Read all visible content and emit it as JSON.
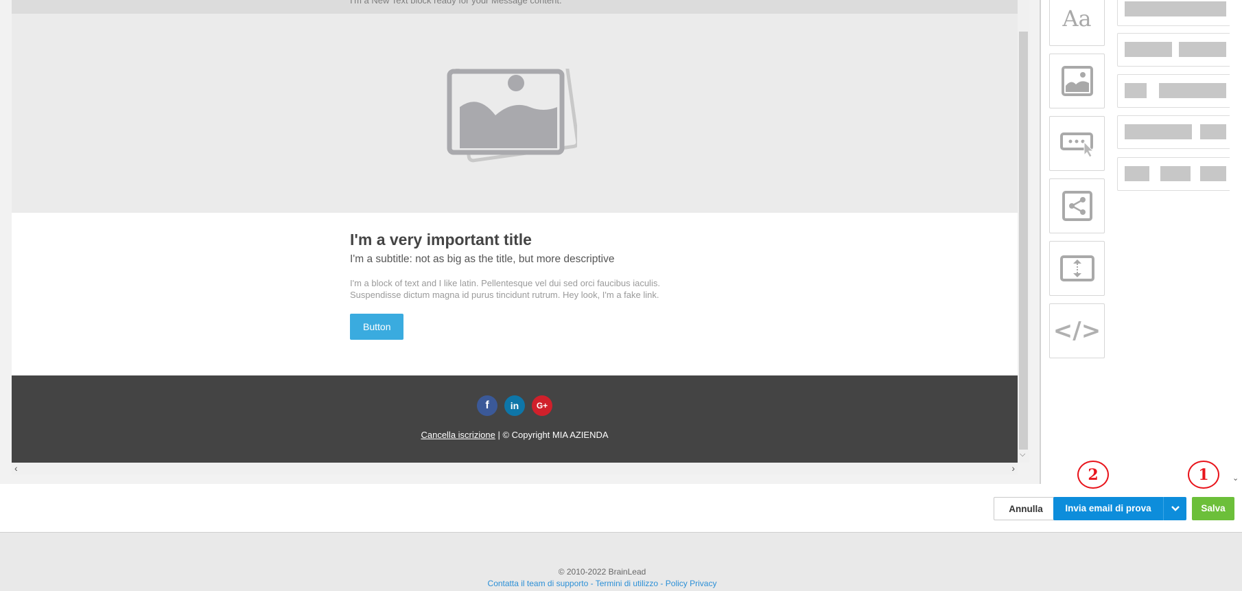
{
  "email": {
    "text_block_note": "I'm a New Text block ready for your Message content.",
    "title": "I'm a very important title",
    "subtitle": "I'm a subtitle: not as big as the title, but more descriptive",
    "paragraph": "I'm a block of text and I like latin. Pellentesque vel dui sed orci faucibus iaculis. Suspendisse dictum magna id purus tincidunt rutrum. Hey look, I'm a fake link.",
    "button_label": "Button",
    "footer": {
      "socials": [
        "f",
        "in",
        "G+"
      ],
      "unsubscribe_link": "Cancella iscrizione",
      "copyright": " | © Copyright MIA AZIENDA"
    }
  },
  "tools": {
    "text_icon_label": "Aa",
    "code_icon_label": "</>"
  },
  "actions": {
    "cancel_label": "Annulla",
    "test_email_label": "Invia email di prova",
    "save_label": "Salva"
  },
  "annotations": [
    "1",
    "2"
  ],
  "page_footer": {
    "copyright": "© 2010-2022 BrainLead",
    "support_link": "Contatta il team di supporto",
    "sep1": " - ",
    "terms_link": "Termini di utilizzo",
    "sep2": " - ",
    "privacy_link": "Policy Privacy"
  },
  "colors": {
    "primary_blue": "#0d8ddb",
    "save_green": "#6cbf3a",
    "email_button": "#3aabdf",
    "footer_dark": "#444444",
    "marker_red": "#e8141b"
  }
}
